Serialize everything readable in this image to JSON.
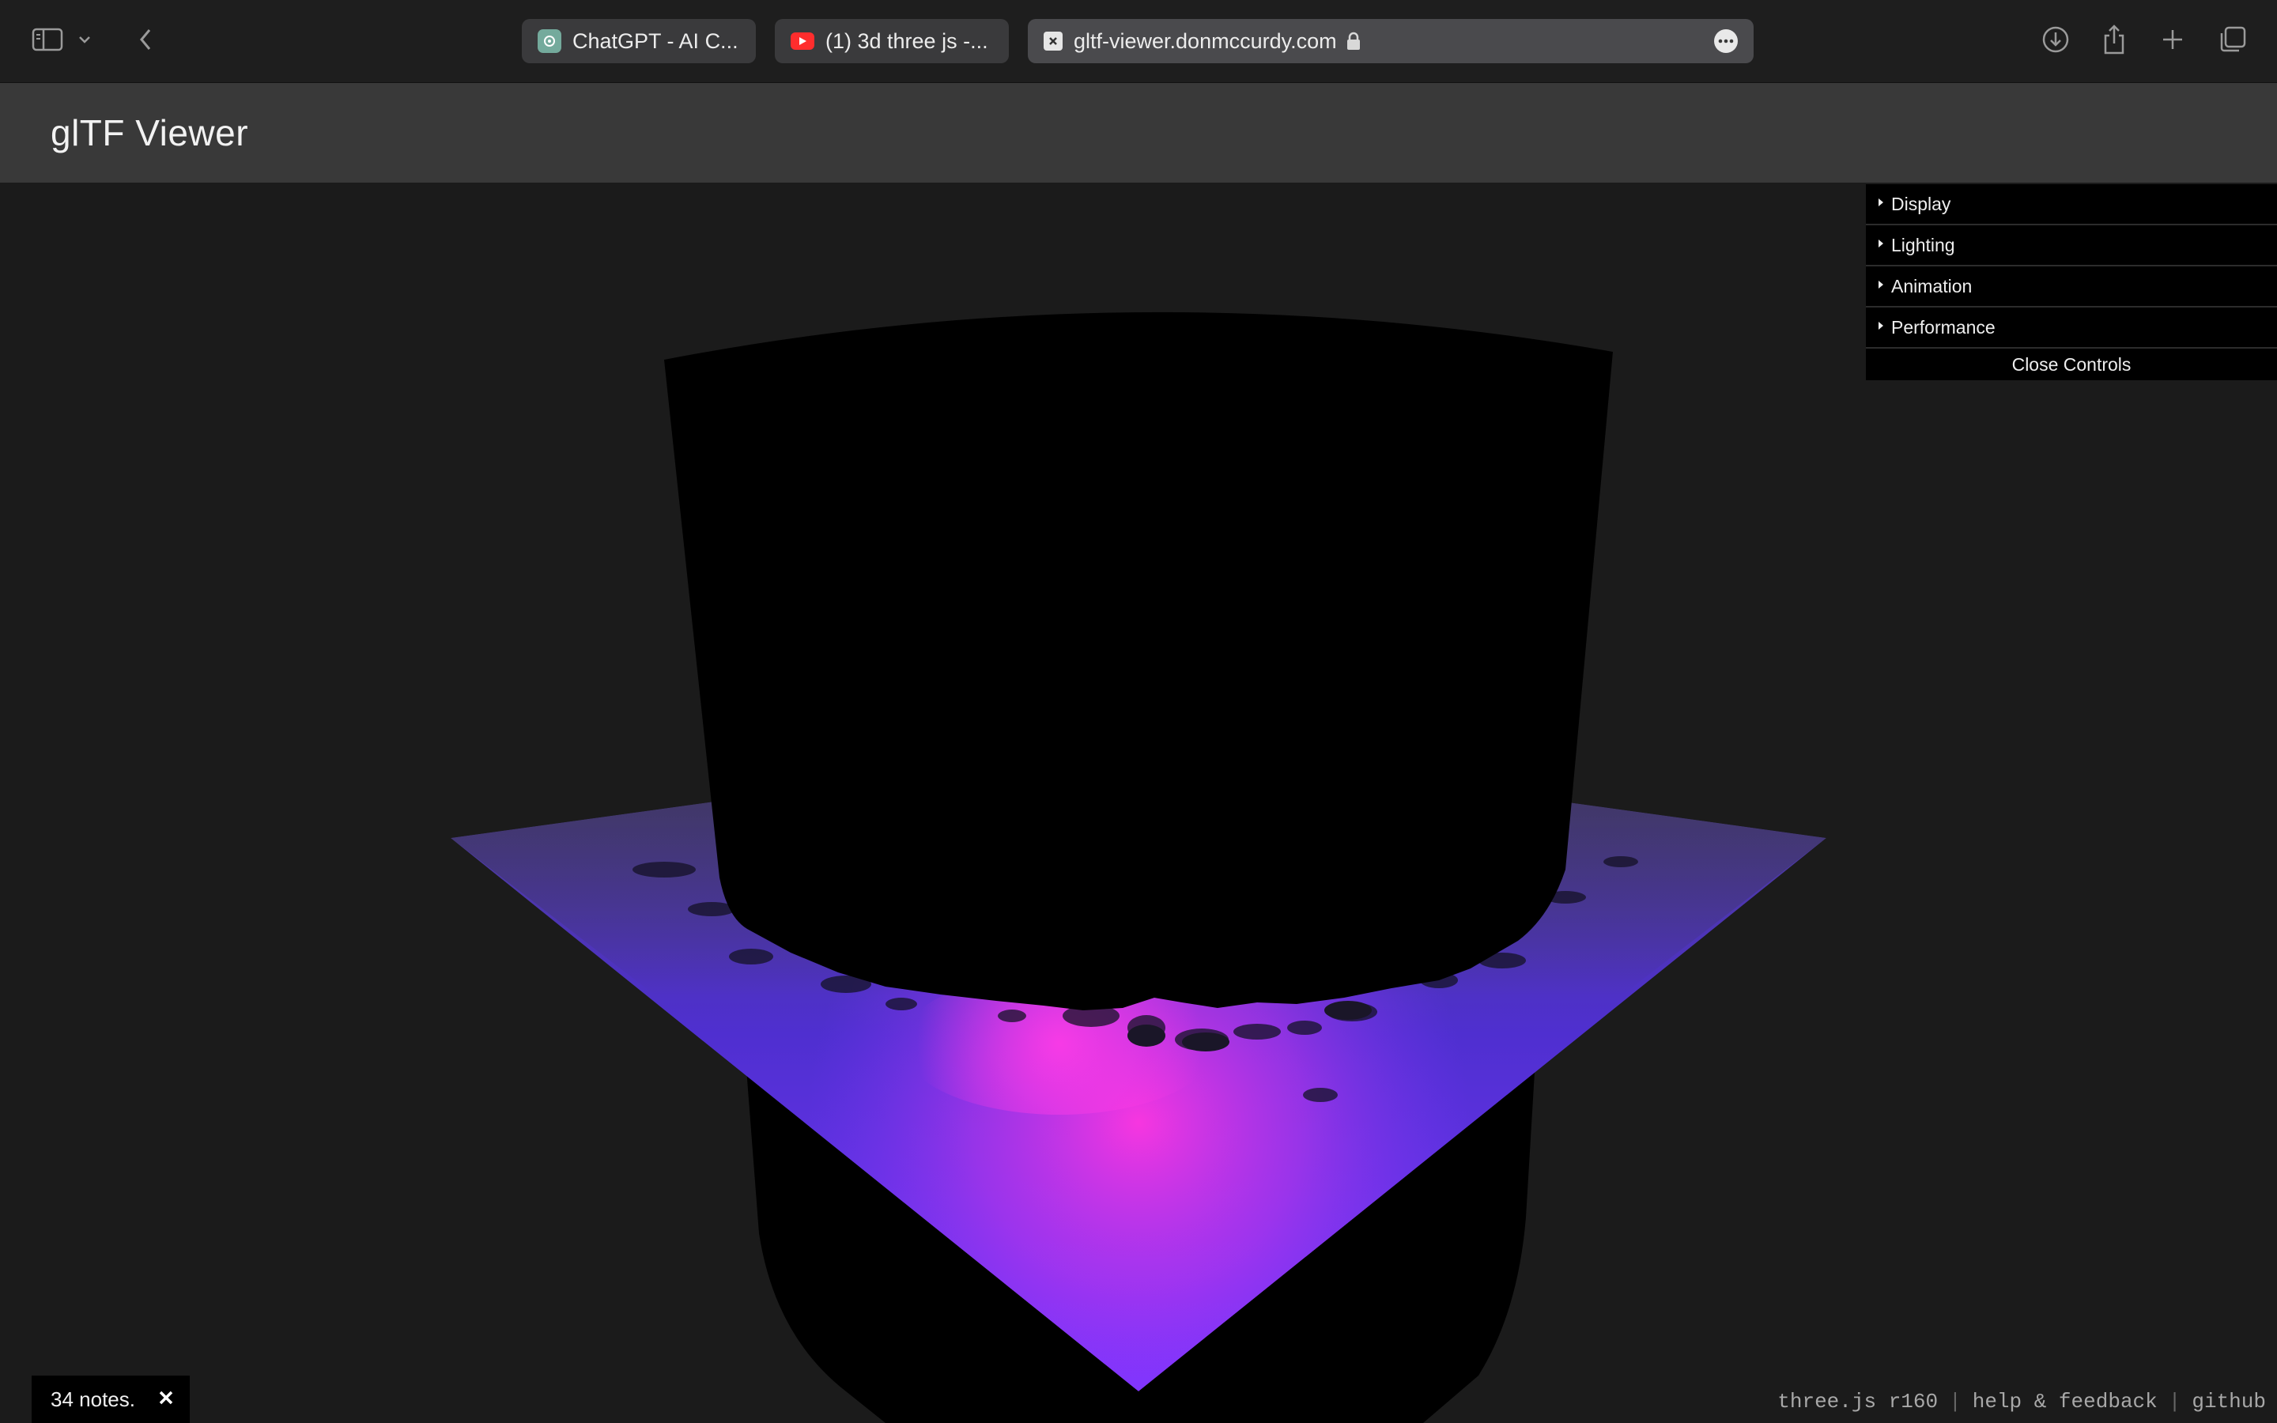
{
  "browser": {
    "tabs": [
      {
        "title": "ChatGPT - AI C...",
        "icon": "chatgpt-icon"
      },
      {
        "title": "(1) 3d three js -...",
        "icon": "youtube-icon"
      }
    ],
    "address_bar": {
      "url": "gltf-viewer.donmccurdy.com",
      "icon": "site-icon",
      "secure": true
    }
  },
  "app": {
    "title": "glTF Viewer"
  },
  "controls": {
    "folders": [
      "Display",
      "Lighting",
      "Animation",
      "Performance"
    ],
    "close_label": "Close Controls"
  },
  "notes": {
    "label": "34 notes."
  },
  "footer": {
    "version": "three.js r160",
    "help": "help & feedback",
    "github": "github"
  },
  "colors": {
    "background": "#1b1b1b",
    "header": "#393939",
    "plane_pink": "#f22fd9",
    "plane_violet": "#6a34ff"
  }
}
